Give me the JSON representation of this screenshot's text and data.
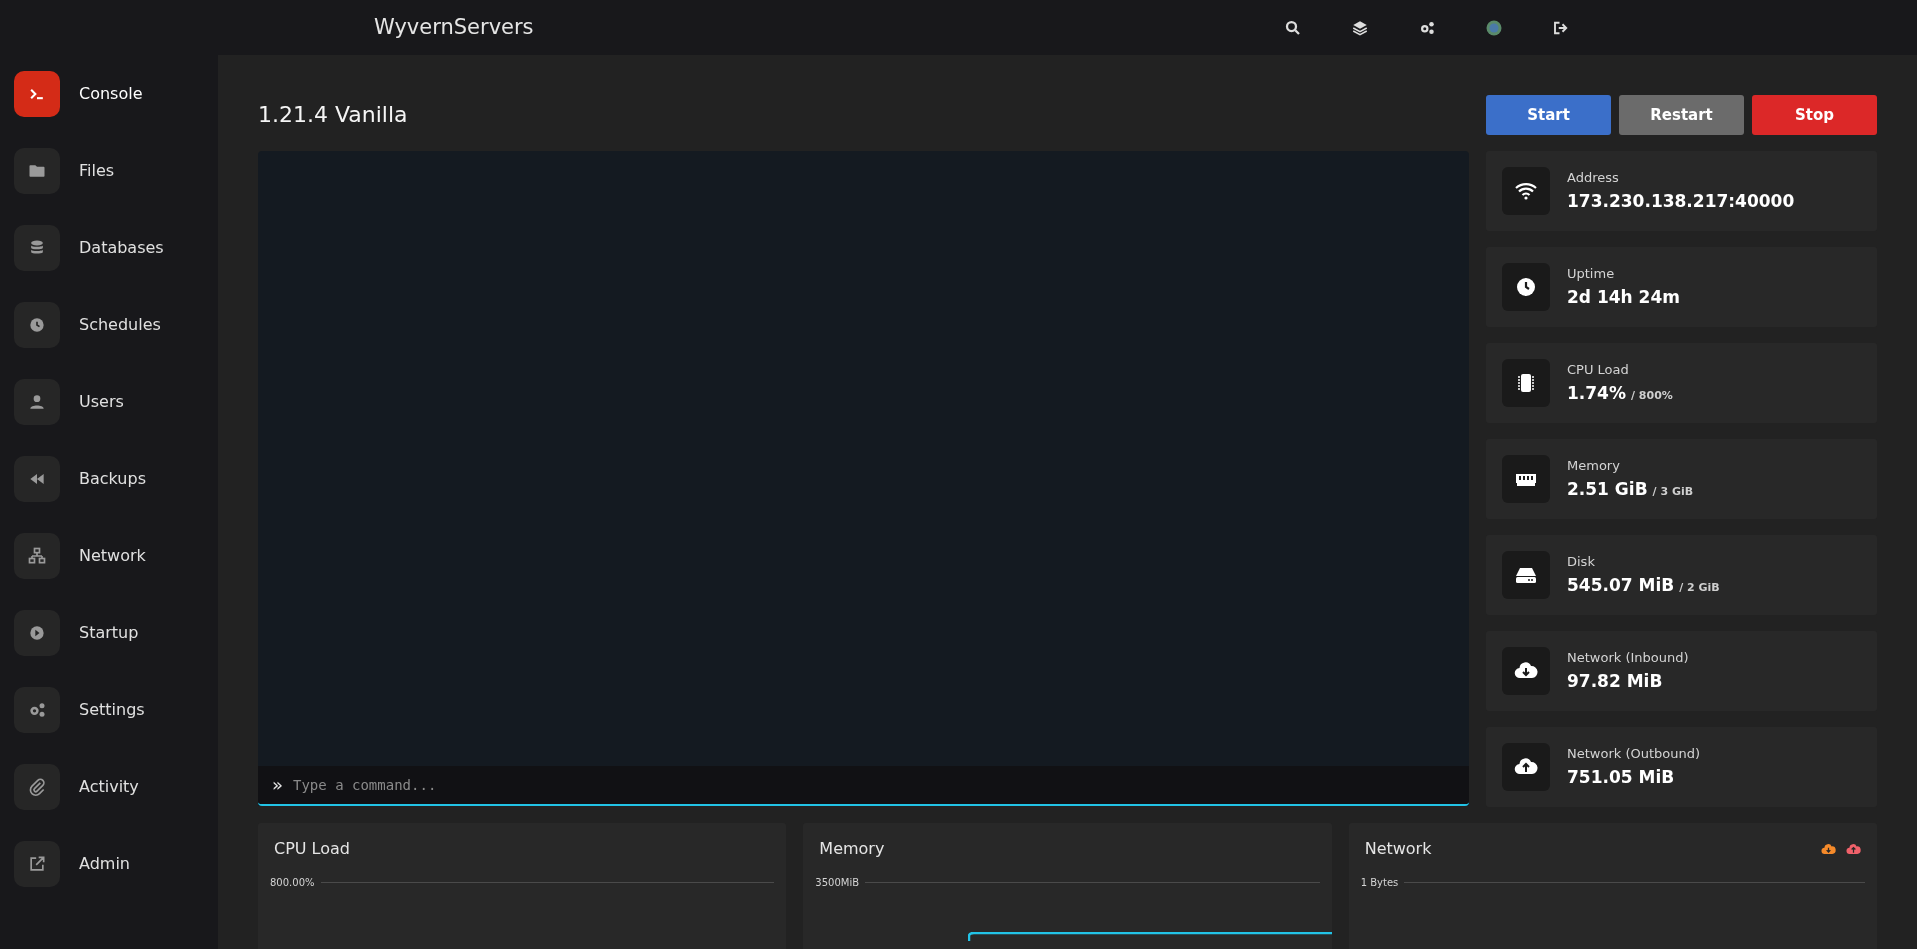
{
  "topbar": {
    "brand": "WyvernServers"
  },
  "sidebar": {
    "items": [
      {
        "label": "Console",
        "selected": true
      },
      {
        "label": "Files",
        "selected": false
      },
      {
        "label": "Databases",
        "selected": false
      },
      {
        "label": "Schedules",
        "selected": false
      },
      {
        "label": "Users",
        "selected": false
      },
      {
        "label": "Backups",
        "selected": false
      },
      {
        "label": "Network",
        "selected": false
      },
      {
        "label": "Startup",
        "selected": false
      },
      {
        "label": "Settings",
        "selected": false
      },
      {
        "label": "Activity",
        "selected": false
      },
      {
        "label": "Admin",
        "selected": false
      }
    ]
  },
  "server": {
    "title": "1.21.4 Vanilla"
  },
  "power_buttons": [
    {
      "label": "Start",
      "kind": "start"
    },
    {
      "label": "Restart",
      "kind": "restart"
    },
    {
      "label": "Stop",
      "kind": "stop"
    }
  ],
  "console": {
    "prompt": "»",
    "placeholder": "Type a command..."
  },
  "stats": [
    {
      "label": "Address",
      "value": "173.230.138.217:40000"
    },
    {
      "label": "Uptime",
      "value": "2d 14h 24m"
    },
    {
      "label": "CPU Load",
      "value": "1.74%",
      "limit": "/ 800%"
    },
    {
      "label": "Memory",
      "value": "2.51 GiB",
      "limit": "/ 3 GiB"
    },
    {
      "label": "Disk",
      "value": "545.07 MiB",
      "limit": "/ 2 GiB"
    },
    {
      "label": "Network (Inbound)",
      "value": "97.82 MiB"
    },
    {
      "label": "Network (Outbound)",
      "value": "751.05 MiB"
    }
  ],
  "charts": [
    {
      "title": "CPU Load",
      "top_tick": "800.00%"
    },
    {
      "title": "Memory",
      "top_tick": "3500MiB"
    },
    {
      "title": "Network",
      "top_tick": "1 Bytes",
      "legend_icons": true
    }
  ]
}
